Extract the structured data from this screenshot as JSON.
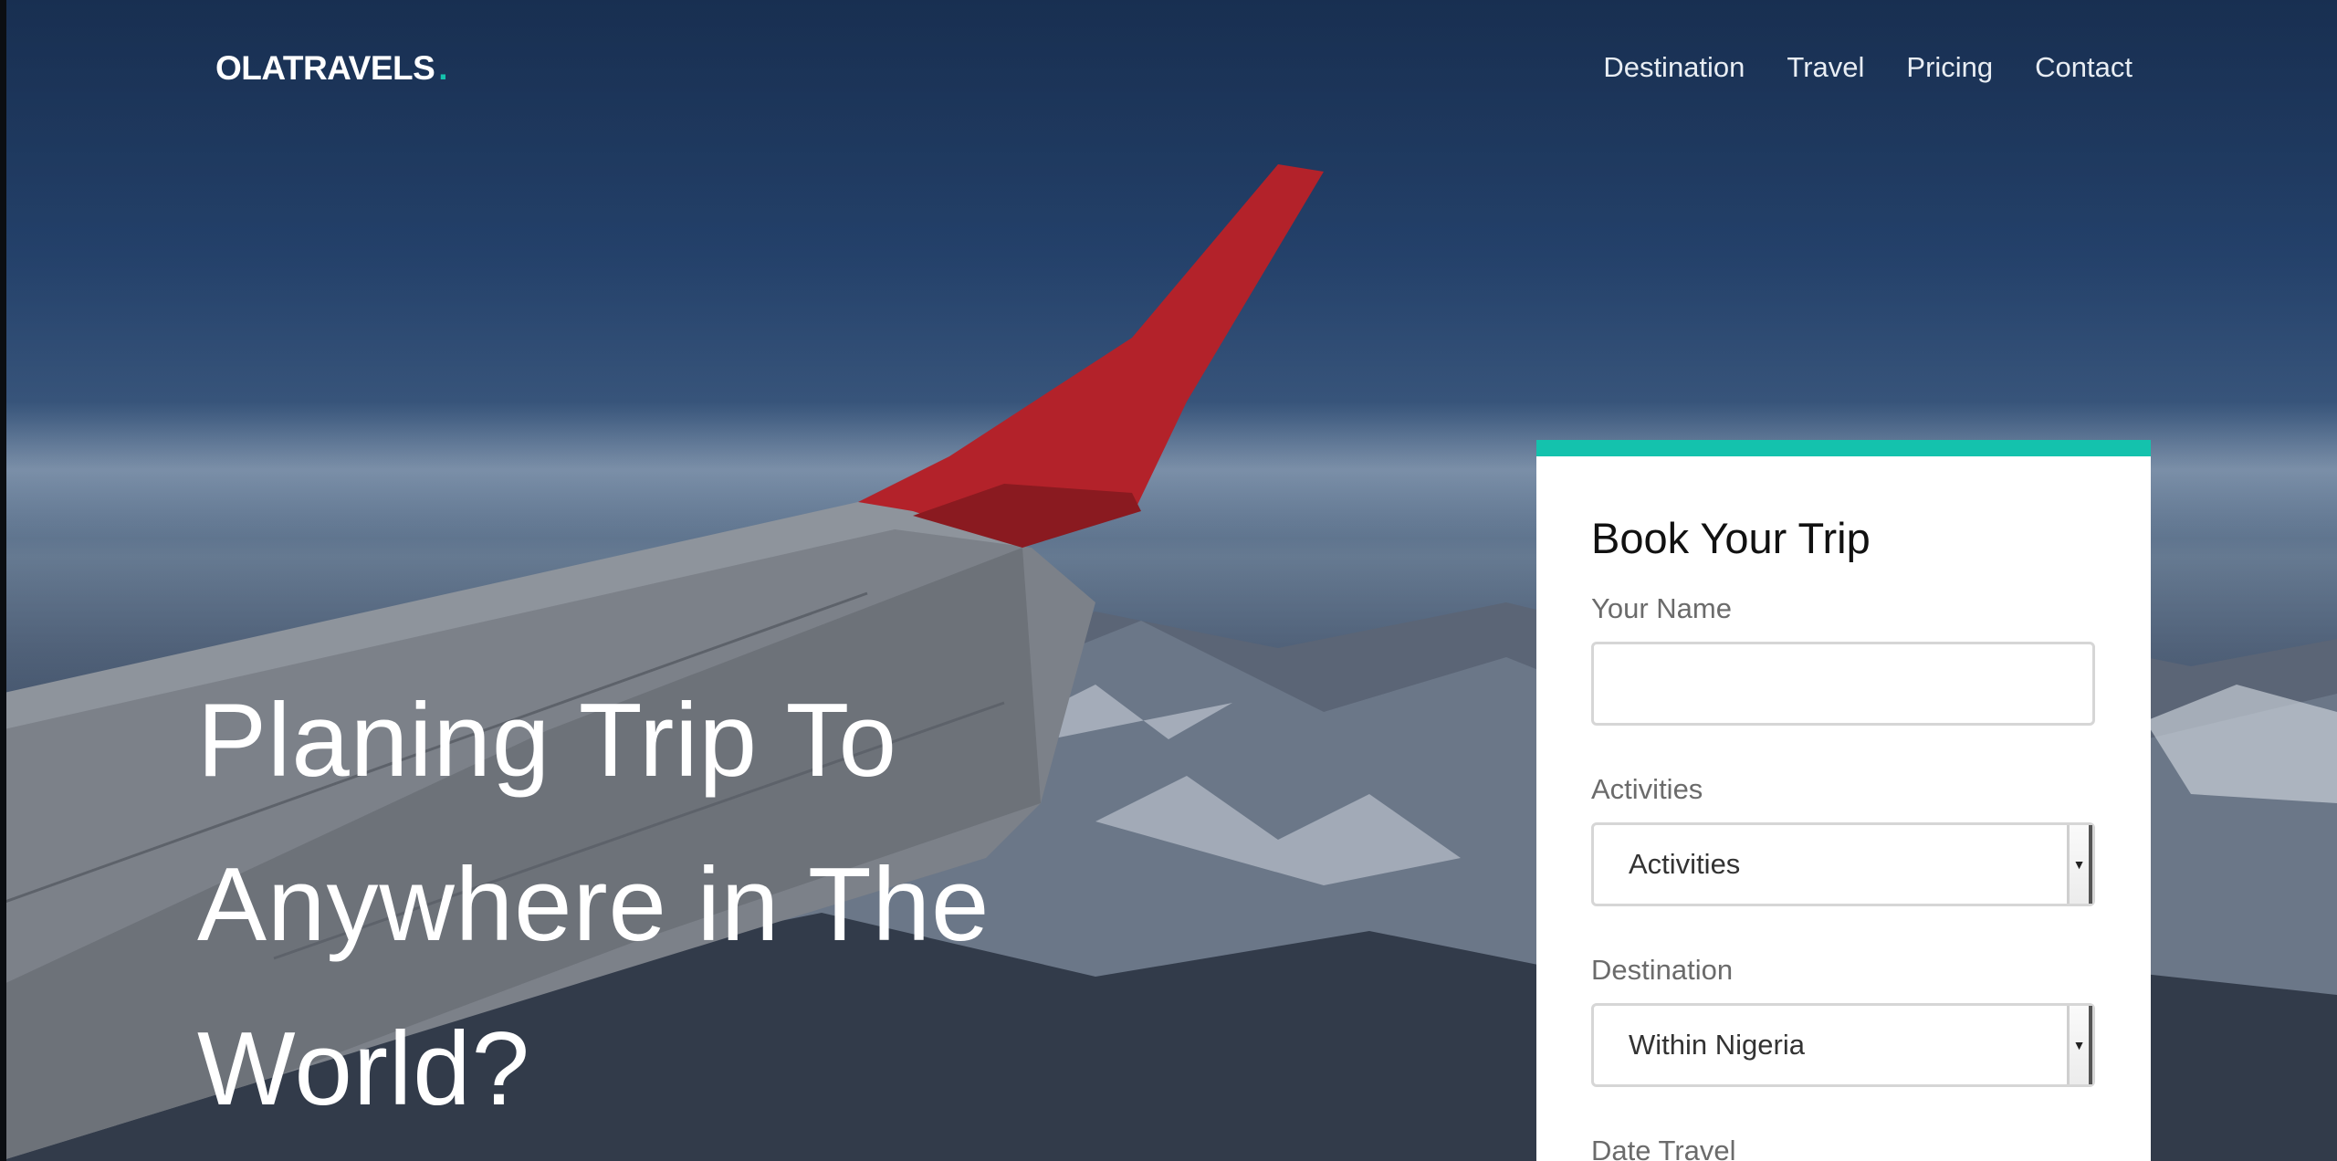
{
  "brand": {
    "name": "OLATRAVELS",
    "dot": ".",
    "accent_color": "#14c2ad"
  },
  "nav": {
    "items": [
      {
        "label": "Destination"
      },
      {
        "label": "Travel"
      },
      {
        "label": "Pricing"
      },
      {
        "label": "Contact"
      }
    ]
  },
  "hero": {
    "line1": "Planing Trip To",
    "line2": "Anywhere in The",
    "line3": "World?"
  },
  "booking": {
    "title": "Book Your Trip",
    "name_label": "Your Name",
    "name_value": "",
    "activities_label": "Activities",
    "activities_value": "Activities",
    "destination_label": "Destination",
    "destination_value": "Within Nigeria",
    "date_label": "Date Travel",
    "dropdown_icon": "caret-down-icon"
  },
  "background": {
    "scene": "airplane-wing-over-mountains"
  }
}
